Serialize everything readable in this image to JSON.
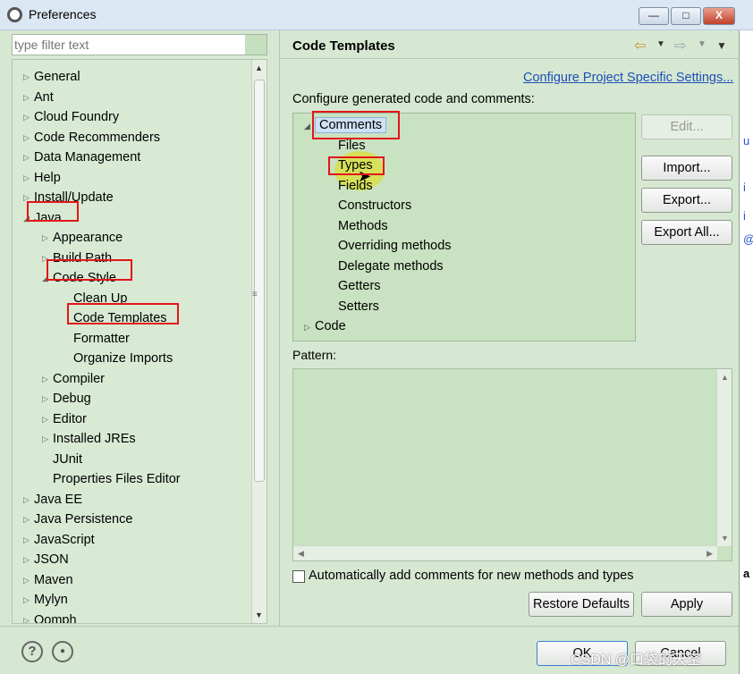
{
  "window": {
    "title": "Preferences",
    "minimize": "—",
    "maximize": "□",
    "close": "X"
  },
  "filter": {
    "placeholder": "type filter text"
  },
  "tree": [
    {
      "label": "General",
      "level": 0,
      "twisty": "closed"
    },
    {
      "label": "Ant",
      "level": 0,
      "twisty": "closed"
    },
    {
      "label": "Cloud Foundry",
      "level": 0,
      "twisty": "closed"
    },
    {
      "label": "Code Recommenders",
      "level": 0,
      "twisty": "closed"
    },
    {
      "label": "Data Management",
      "level": 0,
      "twisty": "closed"
    },
    {
      "label": "Help",
      "level": 0,
      "twisty": "closed"
    },
    {
      "label": "Install/Update",
      "level": 0,
      "twisty": "closed"
    },
    {
      "label": "Java",
      "level": 0,
      "twisty": "open"
    },
    {
      "label": "Appearance",
      "level": 1,
      "twisty": "closed"
    },
    {
      "label": "Build Path",
      "level": 1,
      "twisty": "closed"
    },
    {
      "label": "Code Style",
      "level": 1,
      "twisty": "open"
    },
    {
      "label": "Clean Up",
      "level": 2,
      "twisty": "none"
    },
    {
      "label": "Code Templates",
      "level": 2,
      "twisty": "none"
    },
    {
      "label": "Formatter",
      "level": 2,
      "twisty": "none"
    },
    {
      "label": "Organize Imports",
      "level": 2,
      "twisty": "none"
    },
    {
      "label": "Compiler",
      "level": 1,
      "twisty": "closed"
    },
    {
      "label": "Debug",
      "level": 1,
      "twisty": "closed"
    },
    {
      "label": "Editor",
      "level": 1,
      "twisty": "closed"
    },
    {
      "label": "Installed JREs",
      "level": 1,
      "twisty": "closed"
    },
    {
      "label": "JUnit",
      "level": 1,
      "twisty": "none"
    },
    {
      "label": "Properties Files Editor",
      "level": 1,
      "twisty": "none"
    },
    {
      "label": "Java EE",
      "level": 0,
      "twisty": "closed"
    },
    {
      "label": "Java Persistence",
      "level": 0,
      "twisty": "closed"
    },
    {
      "label": "JavaScript",
      "level": 0,
      "twisty": "closed"
    },
    {
      "label": "JSON",
      "level": 0,
      "twisty": "closed"
    },
    {
      "label": "Maven",
      "level": 0,
      "twisty": "closed"
    },
    {
      "label": "Mylyn",
      "level": 0,
      "twisty": "closed"
    },
    {
      "label": "Oomph",
      "level": 0,
      "twisty": "closed"
    }
  ],
  "page": {
    "title": "Code Templates",
    "project_link": "Configure Project Specific Settings...",
    "description": "Configure generated code and comments:",
    "templates": [
      {
        "label": "Comments",
        "level": 0,
        "twisty": "open",
        "selected": true
      },
      {
        "label": "Files",
        "level": 1,
        "twisty": "none"
      },
      {
        "label": "Types",
        "level": 1,
        "twisty": "none"
      },
      {
        "label": "Fields",
        "level": 1,
        "twisty": "none"
      },
      {
        "label": "Constructors",
        "level": 1,
        "twisty": "none"
      },
      {
        "label": "Methods",
        "level": 1,
        "twisty": "none"
      },
      {
        "label": "Overriding methods",
        "level": 1,
        "twisty": "none"
      },
      {
        "label": "Delegate methods",
        "level": 1,
        "twisty": "none"
      },
      {
        "label": "Getters",
        "level": 1,
        "twisty": "none"
      },
      {
        "label": "Setters",
        "level": 1,
        "twisty": "none"
      },
      {
        "label": "Code",
        "level": 0,
        "twisty": "closed"
      }
    ],
    "buttons": {
      "edit": "Edit...",
      "import": "Import...",
      "export": "Export...",
      "export_all": "Export All..."
    },
    "pattern_label": "Pattern:",
    "auto_comment_label": "Automatically add comments for new methods and types",
    "restore_defaults": "Restore Defaults",
    "apply": "Apply"
  },
  "bottom": {
    "ok": "OK",
    "cancel": "Cancel",
    "help_glyph": "?",
    "watermark": "CSDN @口袋的天空"
  },
  "colors": {
    "highlight_box": "#e3151a",
    "panel_bg": "#d6e8d2",
    "link": "#1d4fb7"
  }
}
